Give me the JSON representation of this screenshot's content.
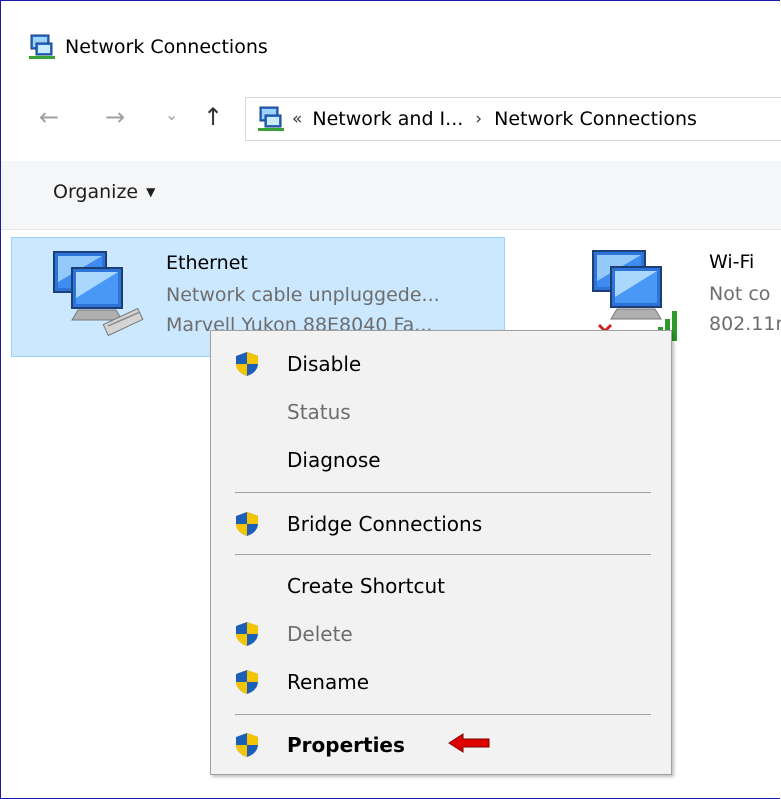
{
  "window": {
    "title": "Network Connections"
  },
  "nav": {
    "back_glyph": "←",
    "forward_glyph": "→",
    "recent_glyph": "⌄",
    "up_glyph": "↑",
    "breadcrumb_overflow": "«",
    "breadcrumbs": [
      {
        "label": "Network and I..."
      },
      {
        "label": "Network Connections"
      }
    ],
    "separator": "›"
  },
  "command_bar": {
    "organize_label": "Organize",
    "organize_caret": "▼"
  },
  "connections": [
    {
      "name": "Ethernet",
      "status": "Network cable unpluggede...",
      "device": "Marvell Yukon 88E8040 Fa...",
      "icon": "ethernet-adapter-icon",
      "selected": true
    },
    {
      "name": "Wi-Fi",
      "status": "Not co",
      "device": "802.11r",
      "icon": "wifi-adapter-icon",
      "selected": false
    }
  ],
  "context_menu": {
    "items": [
      {
        "label": "Disable",
        "shield": true,
        "enabled": true
      },
      {
        "label": "Status",
        "shield": false,
        "enabled": false
      },
      {
        "label": "Diagnose",
        "shield": false,
        "enabled": true
      },
      {
        "label": "Bridge Connections",
        "shield": true,
        "enabled": true
      },
      {
        "label": "Create Shortcut",
        "shield": false,
        "enabled": true
      },
      {
        "label": "Delete",
        "shield": true,
        "enabled": false
      },
      {
        "label": "Rename",
        "shield": true,
        "enabled": true
      },
      {
        "label": "Properties",
        "shield": true,
        "enabled": true,
        "bold": true
      }
    ]
  },
  "colors": {
    "selection_bg": "#cce8ff",
    "selection_border": "#99d1ff",
    "menu_bg": "#f2f2f2",
    "annotation_arrow": "#e00000",
    "shield_blue": "#1c5fb8",
    "shield_yellow": "#f5c400"
  }
}
